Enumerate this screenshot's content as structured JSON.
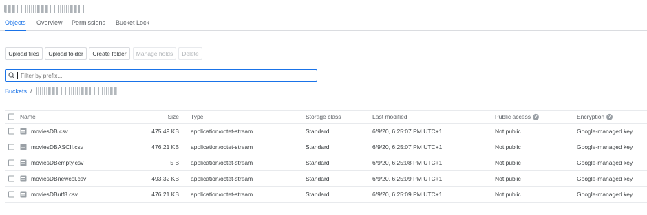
{
  "tabs": [
    {
      "label": "Objects"
    },
    {
      "label": "Overview"
    },
    {
      "label": "Permissions"
    },
    {
      "label": "Bucket Lock"
    }
  ],
  "toolbar": {
    "upload_files": "Upload files",
    "upload_folder": "Upload folder",
    "create_folder": "Create folder",
    "manage_holds": "Manage holds",
    "delete": "Delete"
  },
  "filter": {
    "placeholder": "Filter by prefix..."
  },
  "breadcrumb": {
    "root": "Buckets",
    "separator": "/"
  },
  "table": {
    "columns": {
      "name": "Name",
      "size": "Size",
      "type": "Type",
      "storage": "Storage class",
      "modified": "Last modified",
      "public": "Public access",
      "encryption": "Encryption"
    },
    "rows": [
      {
        "name": "moviesDB.csv",
        "size": "475.49 KB",
        "type": "application/octet-stream",
        "storage": "Standard",
        "modified": "6/9/20, 6:25:07 PM UTC+1",
        "public": "Not public",
        "encryption": "Google-managed key"
      },
      {
        "name": "moviesDBASCII.csv",
        "size": "476.21 KB",
        "type": "application/octet-stream",
        "storage": "Standard",
        "modified": "6/9/20, 6:25:07 PM UTC+1",
        "public": "Not public",
        "encryption": "Google-managed key"
      },
      {
        "name": "moviesDBempty.csv",
        "size": "5 B",
        "type": "application/octet-stream",
        "storage": "Standard",
        "modified": "6/9/20, 6:25:08 PM UTC+1",
        "public": "Not public",
        "encryption": "Google-managed key"
      },
      {
        "name": "moviesDBnewcol.csv",
        "size": "493.32 KB",
        "type": "application/octet-stream",
        "storage": "Standard",
        "modified": "6/9/20, 6:25:09 PM UTC+1",
        "public": "Not public",
        "encryption": "Google-managed key"
      },
      {
        "name": "moviesDButf8.csv",
        "size": "476.21 KB",
        "type": "application/octet-stream",
        "storage": "Standard",
        "modified": "6/9/20, 6:25:09 PM UTC+1",
        "public": "Not public",
        "encryption": "Google-managed key"
      }
    ]
  },
  "colors": {
    "accent": "#1a73e8",
    "text": "#202124",
    "muted": "#5f6368",
    "divider": "#dadce0"
  }
}
